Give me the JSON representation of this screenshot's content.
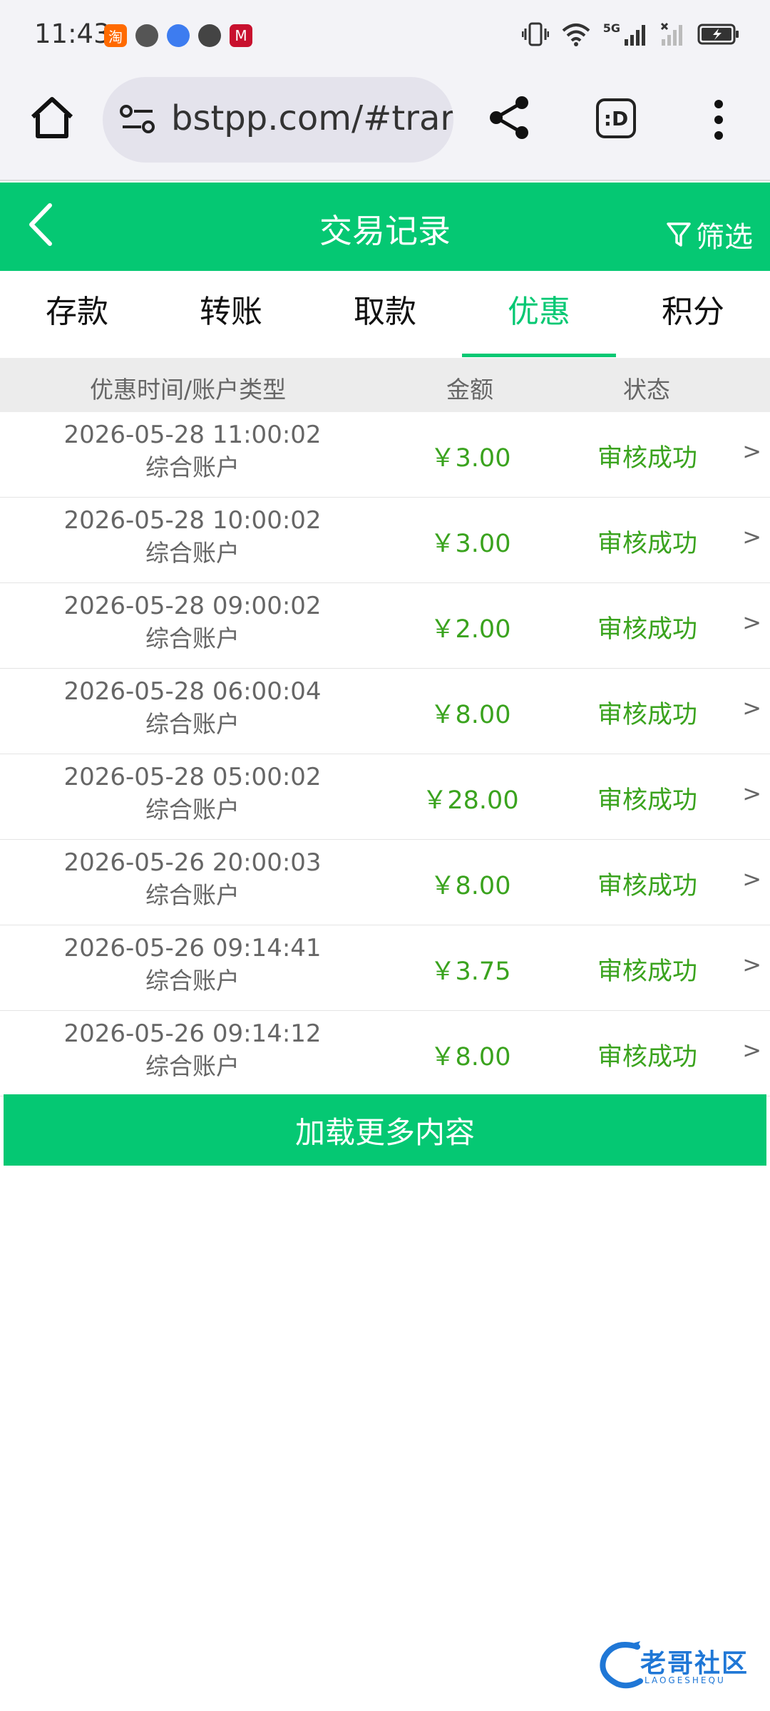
{
  "status_bar": {
    "time": "11:43",
    "apps": [
      {
        "icon": "taobao-icon",
        "glyph": "淘",
        "color": "#ff6a00"
      },
      {
        "icon": "message-icon",
        "glyph": "",
        "color": "#555555"
      },
      {
        "icon": "browser-icon",
        "glyph": "",
        "color": "#3d7cf0"
      },
      {
        "icon": "wechat-icon",
        "glyph": "",
        "color": "#444444"
      },
      {
        "icon": "bank-icon",
        "glyph": "M",
        "color": "#c8102e"
      }
    ],
    "network": "5G"
  },
  "browser": {
    "url": "bstpp.com/#trar",
    "tab_label": ":D"
  },
  "header": {
    "title": "交易记录",
    "filter_label": "筛选"
  },
  "tabs": [
    {
      "label": "存款",
      "active": false
    },
    {
      "label": "转账",
      "active": false
    },
    {
      "label": "取款",
      "active": false
    },
    {
      "label": "优惠",
      "active": true
    },
    {
      "label": "积分",
      "active": false
    }
  ],
  "table": {
    "columns": [
      "优惠时间/账户类型",
      "金额",
      "状态"
    ],
    "rows": [
      {
        "date": "2026-05-28 11:00:02",
        "account": "综合账户",
        "amount": "￥3.00",
        "status": "审核成功"
      },
      {
        "date": "2026-05-28 10:00:02",
        "account": "综合账户",
        "amount": "￥3.00",
        "status": "审核成功"
      },
      {
        "date": "2026-05-28 09:00:02",
        "account": "综合账户",
        "amount": "￥2.00",
        "status": "审核成功"
      },
      {
        "date": "2026-05-28 06:00:04",
        "account": "综合账户",
        "amount": "￥8.00",
        "status": "审核成功"
      },
      {
        "date": "2026-05-28 05:00:02",
        "account": "综合账户",
        "amount": "￥28.00",
        "status": "审核成功"
      },
      {
        "date": "2026-05-26 20:00:03",
        "account": "综合账户",
        "amount": "￥8.00",
        "status": "审核成功"
      },
      {
        "date": "2026-05-26 09:14:41",
        "account": "综合账户",
        "amount": "￥3.75",
        "status": "审核成功"
      },
      {
        "date": "2026-05-26 09:14:12",
        "account": "综合账户",
        "amount": "￥8.00",
        "status": "审核成功"
      }
    ],
    "row_arrow": ">"
  },
  "load_more_label": "加载更多内容",
  "watermark": {
    "text": "老哥社区",
    "sub": "LAOGESHEQU"
  },
  "colors": {
    "accent": "#05c873",
    "amount": "#3aa31e"
  }
}
